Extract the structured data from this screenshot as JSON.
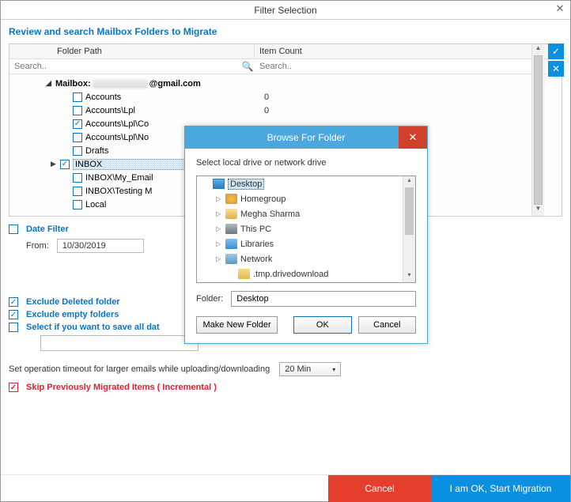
{
  "window": {
    "title": "Filter Selection"
  },
  "subtitle": "Review and search Mailbox Folders to Migrate",
  "grid": {
    "headers": {
      "path": "Folder Path",
      "count": "Item Count"
    },
    "search_placeholder": "Search..",
    "mailbox_prefix": "Mailbox:",
    "mailbox_suffix": "@gmail.com",
    "rows": [
      {
        "label": "Accounts",
        "count": "0",
        "checked": false
      },
      {
        "label": "Accounts\\Lpl",
        "count": "0",
        "checked": false
      },
      {
        "label": "Accounts\\Lpl\\Co",
        "count": "",
        "checked": true
      },
      {
        "label": "Accounts\\Lpl\\No",
        "count": "",
        "checked": false
      },
      {
        "label": "Drafts",
        "count": "",
        "checked": false
      },
      {
        "label": "INBOX",
        "count": "",
        "checked": true,
        "selected": true,
        "expander": true
      },
      {
        "label": "INBOX\\My_Email",
        "count": "",
        "checked": false
      },
      {
        "label": "INBOX\\Testing M",
        "count": "",
        "checked": false
      },
      {
        "label": "Local",
        "count": "",
        "checked": false
      }
    ]
  },
  "date_filter": {
    "label": "Date Filter",
    "from_label": "From:",
    "from_value": "10/30/2019"
  },
  "options": {
    "exclude_deleted": "Exclude Deleted folder",
    "exclude_empty": "Exclude empty folders",
    "save_all": "Select if you want to save all dat"
  },
  "timeout": {
    "label": "Set operation timeout for larger emails while uploading/downloading",
    "value": "20 Min"
  },
  "skip": {
    "label": "Skip Previously Migrated Items ( Incremental )"
  },
  "footer": {
    "cancel": "Cancel",
    "ok": "I am OK, Start Migration"
  },
  "modal": {
    "title": "Browse For Folder",
    "instruction": "Select local drive or network drive",
    "tree": [
      {
        "label": "Desktop",
        "icon": "desktop",
        "selected": true,
        "indent": 0,
        "expander": ""
      },
      {
        "label": "Homegroup",
        "icon": "home",
        "indent": 1,
        "expander": "▷"
      },
      {
        "label": "Megha Sharma",
        "icon": "user",
        "indent": 1,
        "expander": "▷"
      },
      {
        "label": "This PC",
        "icon": "pc",
        "indent": 1,
        "expander": "▷"
      },
      {
        "label": "Libraries",
        "icon": "lib",
        "indent": 1,
        "expander": "▷"
      },
      {
        "label": "Network",
        "icon": "net",
        "indent": 1,
        "expander": "▷"
      },
      {
        "label": ".tmp.drivedownload",
        "icon": "folder",
        "indent": 2,
        "expander": ""
      }
    ],
    "folder_label": "Folder:",
    "folder_value": "Desktop",
    "buttons": {
      "new": "Make New Folder",
      "ok": "OK",
      "cancel": "Cancel"
    }
  }
}
